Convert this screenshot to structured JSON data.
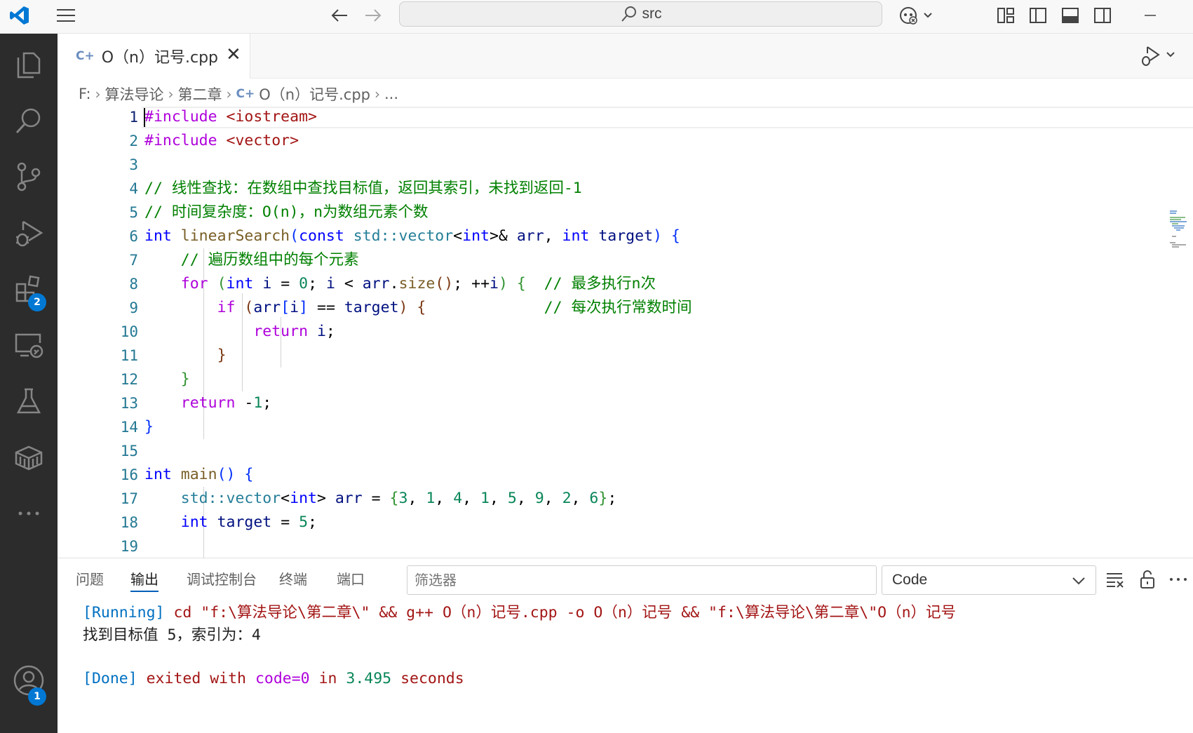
{
  "titlebar": {
    "search_text": "src"
  },
  "activitybar": {
    "extensions_badge": "2",
    "accounts_badge": "1"
  },
  "tab": {
    "icon_text": "C+",
    "label": "O（n）记号.cpp"
  },
  "breadcrumb": {
    "items": [
      "F:",
      "算法导论",
      "第二章",
      "O（n）记号.cpp",
      "..."
    ]
  },
  "editor": {
    "line_numbers": [
      "1",
      "2",
      "3",
      "4",
      "5",
      "6",
      "7",
      "8",
      "9",
      "10",
      "11",
      "12",
      "13",
      "14",
      "15",
      "16",
      "17",
      "18",
      "19"
    ],
    "code": {
      "l1_kw": "#include",
      "l1_str": "<iostream>",
      "l2_kw": "#include",
      "l2_str": "<vector>",
      "l4_comment": "// 线性查找：在数组中查找目标值，返回其索引，未找到返回-1",
      "l5_comment": "// 时间复杂度：O(n)，n为数组元素个数",
      "l6_int": "int",
      "l6_fn": "linearSearch",
      "l6_const": "const",
      "l6_std": "std::vector",
      "l6_int2": "int",
      "l6_arr": "arr",
      "l6_int3": "int",
      "l6_target": "target",
      "l7_comment": "// 遍历数组中的每个元素",
      "l8_for": "for",
      "l8_int": "int",
      "l8_i": "i",
      "l8_zero": "0",
      "l8_i2": "i",
      "l8_arr": "arr",
      "l8_size": "size",
      "l8_i3": "i",
      "l8_comment": "// 最多执行n次",
      "l9_if": "if",
      "l9_arr": "arr",
      "l9_i": "i",
      "l9_target": "target",
      "l9_comment": "// 每次执行常数时间",
      "l10_return": "return",
      "l10_i": "i",
      "l13_return": "return",
      "l13_val": "1",
      "l16_int": "int",
      "l16_main": "main",
      "l17_std": "std::vector",
      "l17_int": "int",
      "l17_arr": "arr",
      "l17_nums": [
        "3",
        "1",
        "4",
        "1",
        "5",
        "9",
        "2",
        "6"
      ],
      "l18_int": "int",
      "l18_target": "target",
      "l18_val": "5"
    }
  },
  "panel": {
    "tabs": [
      "问题",
      "输出",
      "调试控制台",
      "终端",
      "端口"
    ],
    "active_tab": "输出",
    "filter_placeholder": "筛选器",
    "channel": "Code",
    "output": {
      "running_tag": "[Running]",
      "running_cmd": " cd \"f:\\算法导论\\第二章\\\" && g++ O（n）记号.cpp -o O（n）记号 && \"f:\\算法导论\\第二章\\\"O（n）记号",
      "result": "找到目标值 5，索引为：4",
      "done_tag": "[Done]",
      "done_1": " exited with ",
      "done_code": "code=0",
      "done_2": " in ",
      "done_time": "3.495",
      "done_3": " seconds"
    }
  },
  "colors": {
    "activitybar_bg": "#2c2c2c",
    "accent": "#0078d4",
    "keyword": "#0000ff",
    "string": "#a31515",
    "comment": "#008000",
    "number": "#098658"
  }
}
